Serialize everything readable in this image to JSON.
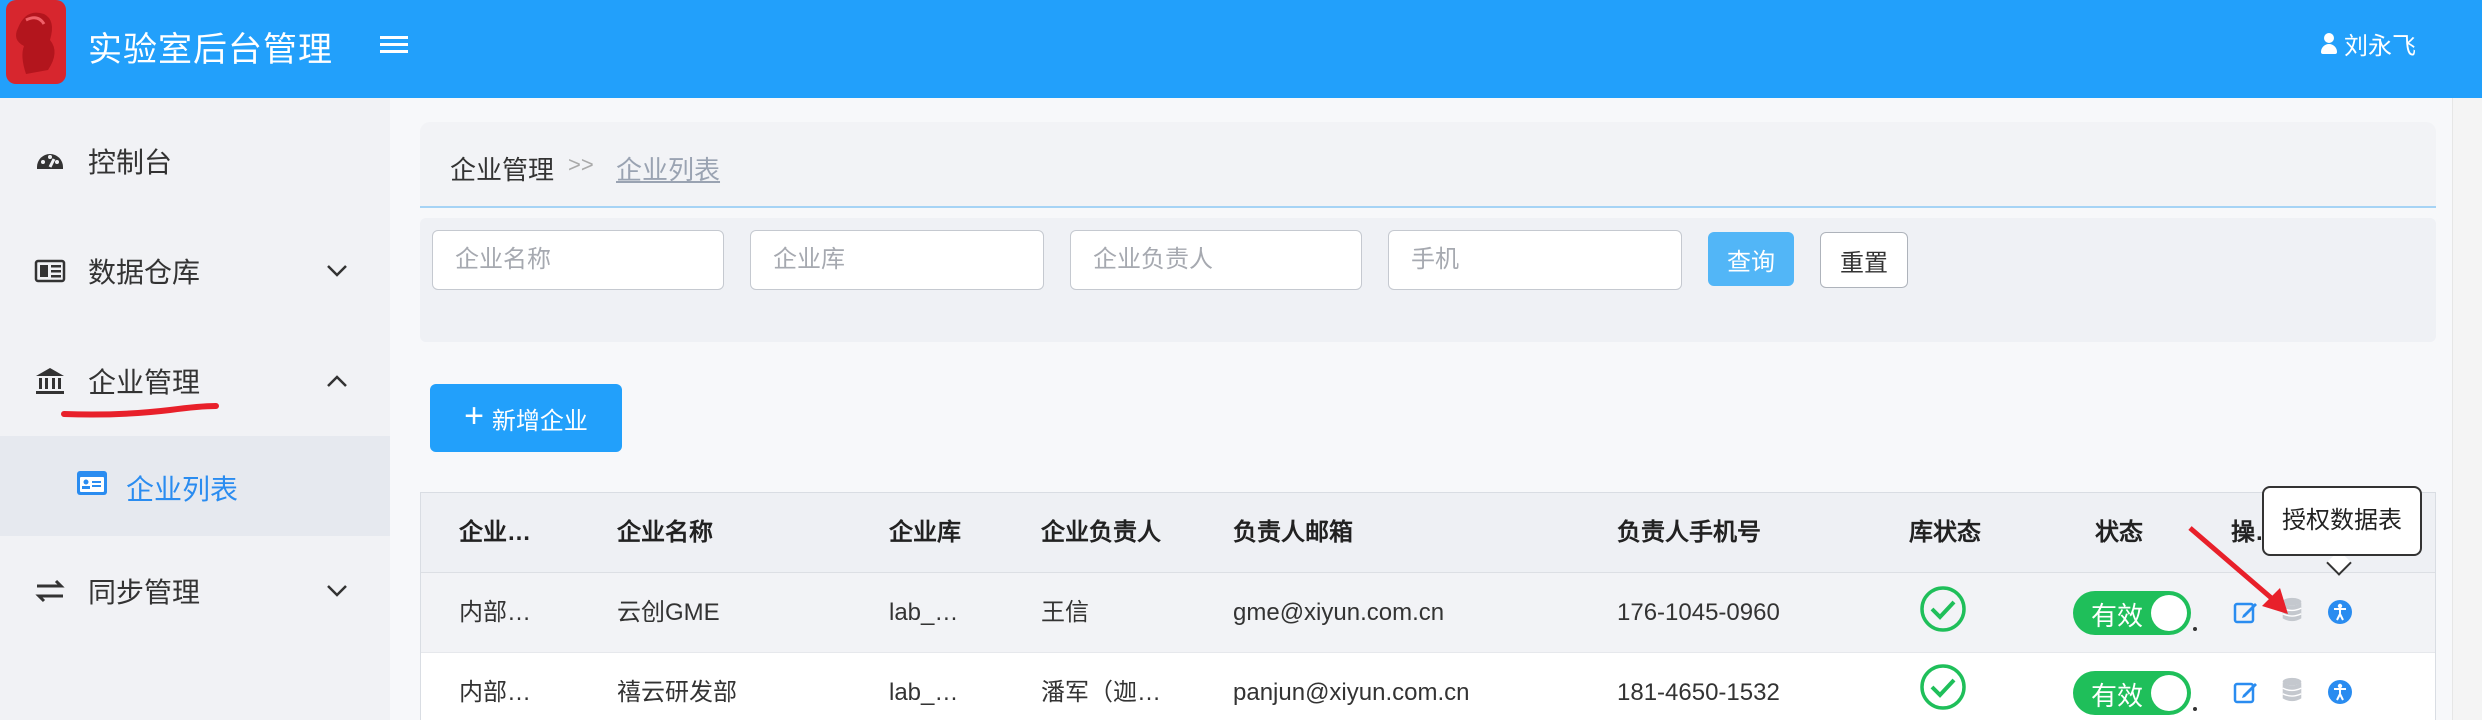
{
  "app": {
    "title": "实验室后台管理",
    "user_name": "刘永飞"
  },
  "sidebar": {
    "items": [
      {
        "label": "控制台",
        "icon": "dashboard-icon"
      },
      {
        "label": "数据仓库",
        "icon": "database-panel-icon",
        "expandable": true
      },
      {
        "label": "企业管理",
        "icon": "bank-icon",
        "expanded": true
      },
      {
        "label": "同步管理",
        "icon": "sync-icon",
        "expandable": true
      }
    ],
    "active_sub": {
      "label": "企业列表",
      "icon": "id-card-icon"
    }
  },
  "breadcrumb": {
    "parent": "企业管理",
    "separator": ">>",
    "current": "企业列表"
  },
  "filters": {
    "name_placeholder": "企业名称",
    "db_placeholder": "企业库",
    "owner_placeholder": "企业负责人",
    "phone_placeholder": "手机",
    "query_label": "查询",
    "reset_label": "重置"
  },
  "add_button": {
    "label": "新增企业"
  },
  "table": {
    "headers": [
      "企业…",
      "企业名称",
      "企业库",
      "企业负责人",
      "负责人邮箱",
      "负责人手机号",
      "库状态",
      "状态",
      "操…"
    ],
    "rows": [
      {
        "type": "内部…",
        "name": "云创GME",
        "db": "lab_…",
        "owner": "王信",
        "email": "gme@xiyun.com.cn",
        "phone": "176-1045-0960",
        "db_status": "ok",
        "status": "有效"
      },
      {
        "type": "内部…",
        "name": "禧云研发部",
        "db": "lab_…",
        "owner": "潘军（迦…",
        "email": "panjun@xiyun.com.cn",
        "phone": "181-4650-1532",
        "db_status": "ok",
        "status": "有效"
      }
    ]
  },
  "tooltip": {
    "text": "授权数据表"
  },
  "colors": {
    "brand": "#22a0fb",
    "active": "#2a8cf0",
    "success": "#1fbf5a",
    "annotation": "#e8202a"
  }
}
